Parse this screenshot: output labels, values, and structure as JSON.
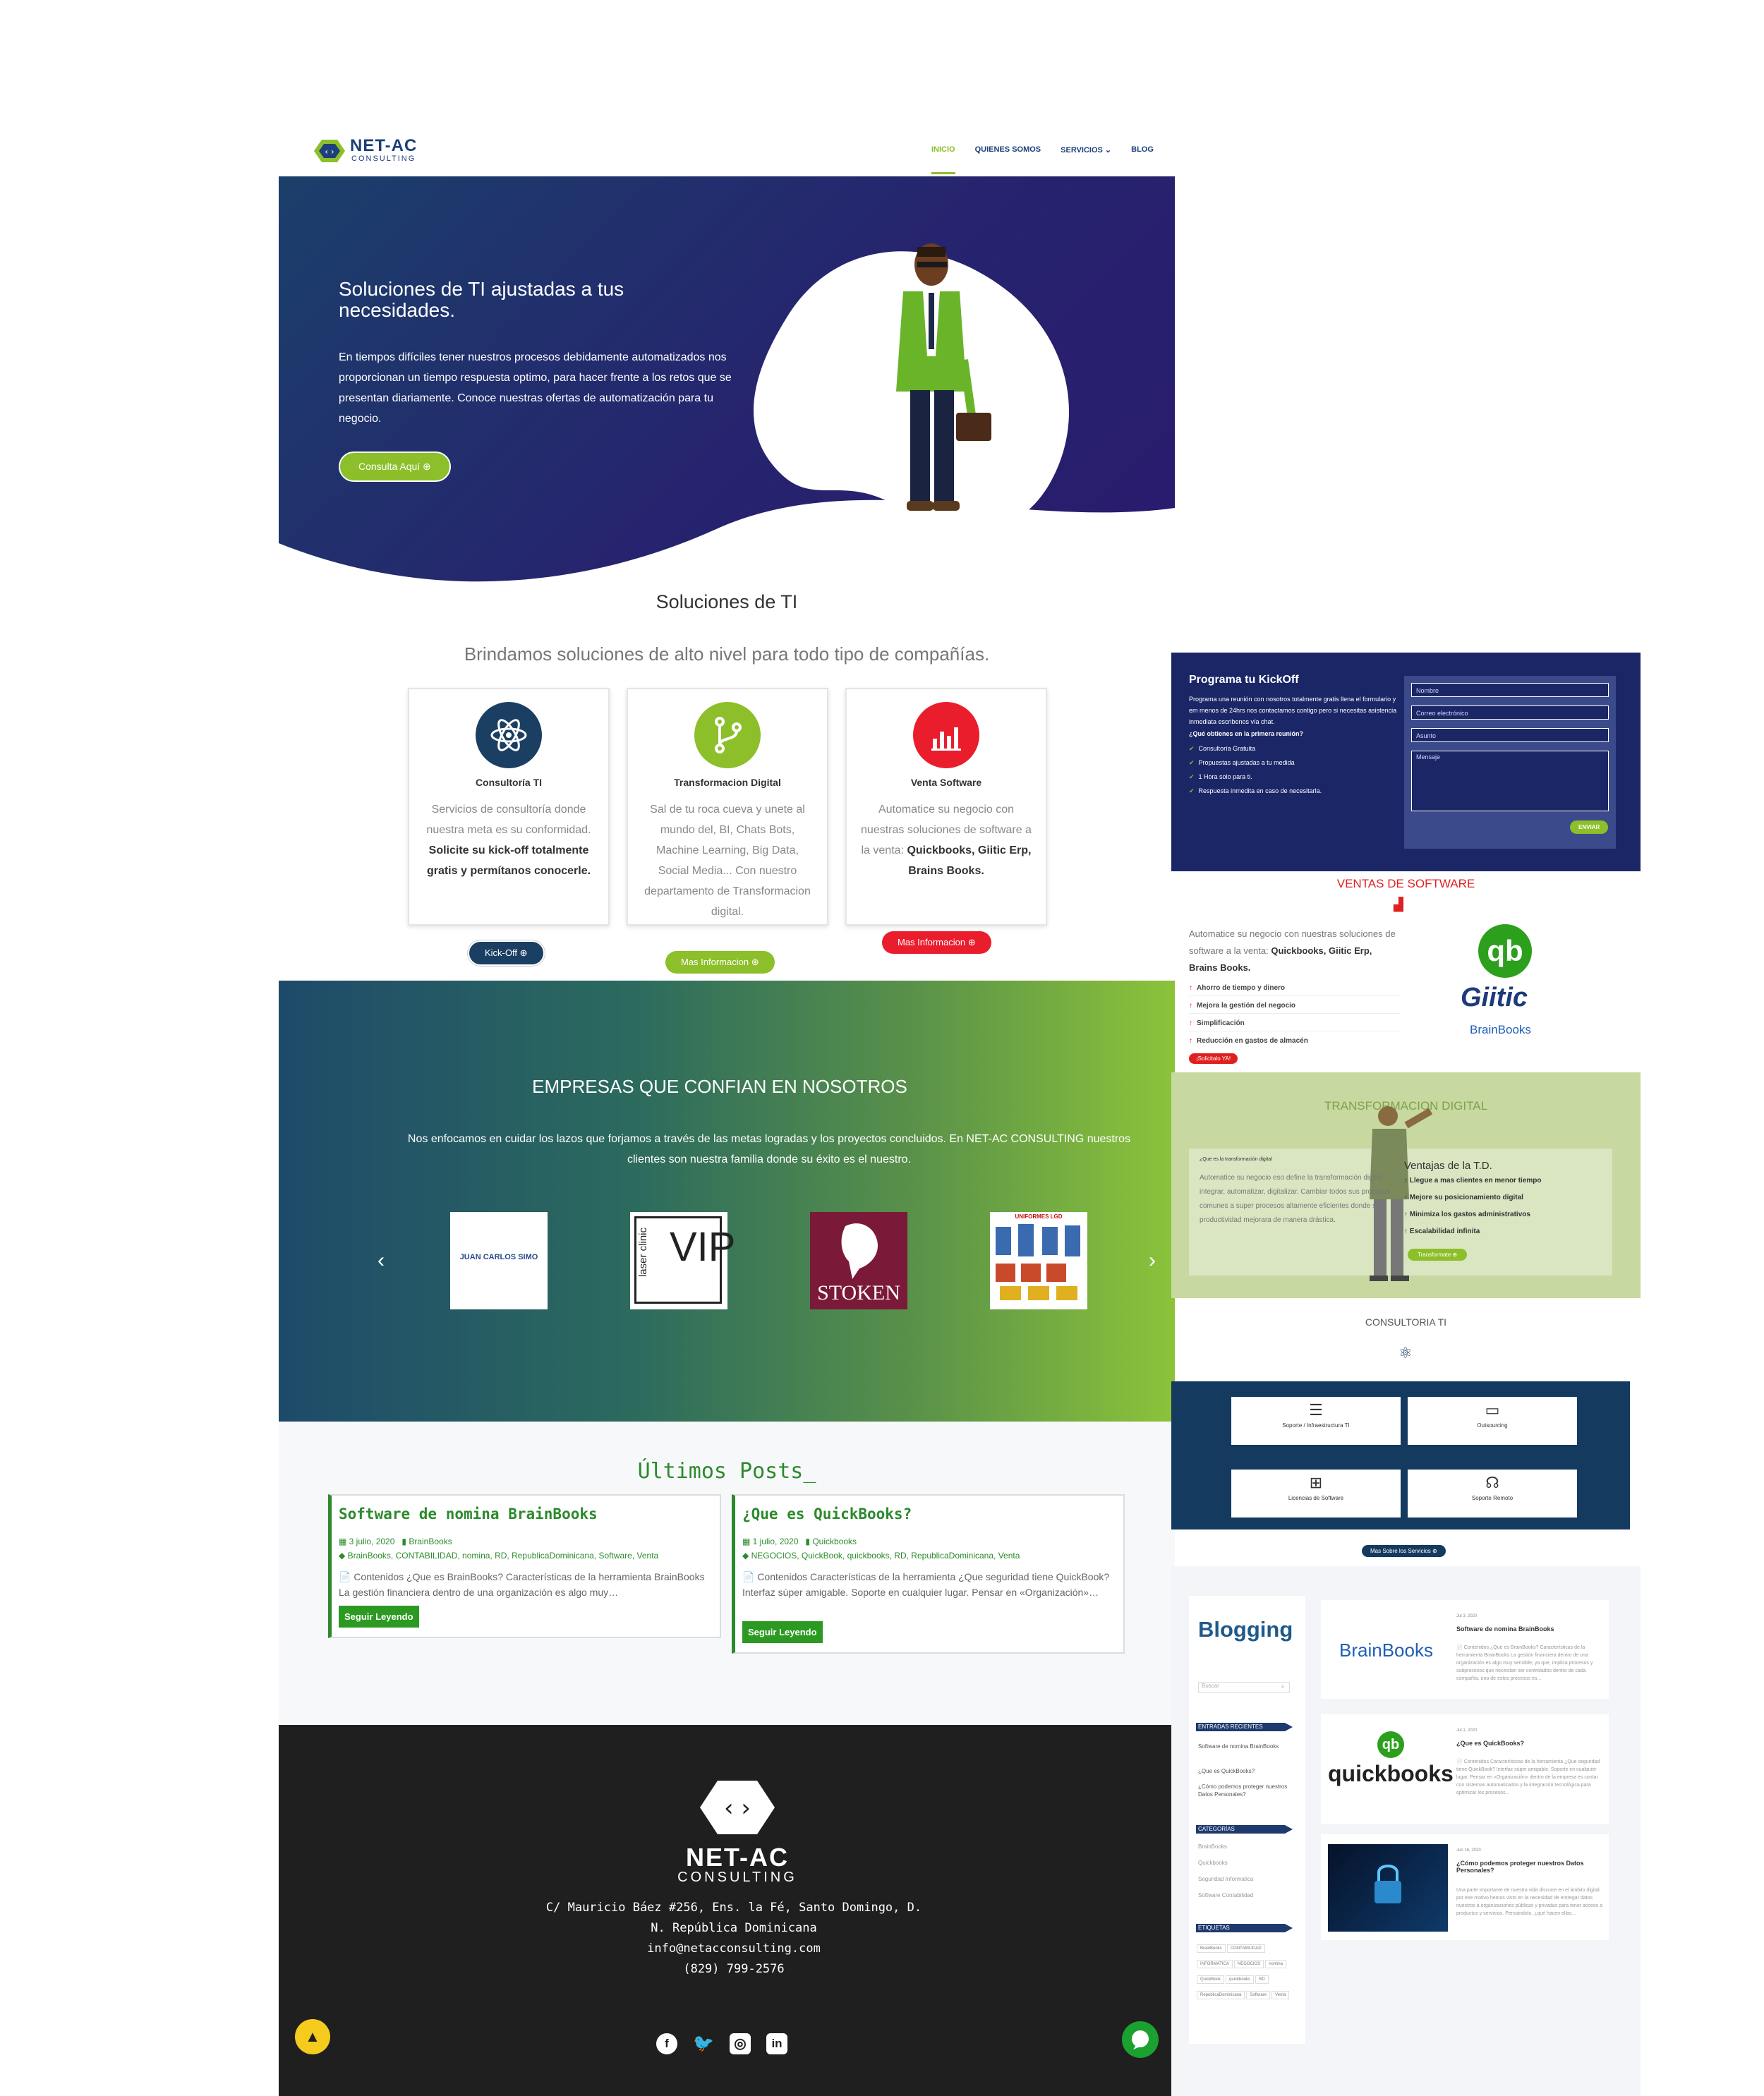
{
  "header": {
    "logo_text": "NET-AC",
    "logo_sub": "CONSULTING",
    "nav": [
      "INICIO",
      "QUIENES SOMOS",
      "SERVICIOS ⌄",
      "BLOG"
    ]
  },
  "hero": {
    "title": "Soluciones de TI ajustadas a tus necesidades.",
    "body": "En tiempos difíciles tener nuestros procesos debidamente automatizados nos proporcionan un tiempo respuesta optimo, para hacer frente a los retos que se presentan diariamente. Conoce nuestras ofertas de automatización para tu negocio.",
    "button": "Consulta Aquí ⊕"
  },
  "solutions": {
    "title": "Soluciones de TI",
    "subtitle": "Brindamos soluciones de alto nivel para todo tipo de compañías.",
    "cards": [
      {
        "title": "Consultoría TI",
        "text_before": "Servicios de consultoría donde nuestra meta es su conformidad. ",
        "text_bold": "Solicite su kick-off totalmente gratis y permítanos conocerle.",
        "button": "Kick-Off ⊕",
        "icon": "atom-icon",
        "color": "#1b3f63",
        "button_color": "#1b3f63"
      },
      {
        "title": "Transformacion Digital",
        "text_before": "Sal de tu roca cueva y unete al mundo del, BI, Chats Bots, Machine Learning, Big Data, Social Media... Con nuestro departamento de Transformacion digital.",
        "text_bold": "",
        "button": "Mas Informacion ⊕",
        "icon": "git-branch-icon",
        "color": "#8cbf2a",
        "button_color": "#8cbf2a"
      },
      {
        "title": "Venta Software",
        "text_before": "Automatice su negocio con nuestras soluciones de software a la venta: ",
        "text_bold": "Quickbooks, Giitic Erp, Brains Books.",
        "button": "Mas Informacion ⊕",
        "icon": "bar-chart-icon",
        "color": "#ea1d2c",
        "button_color": "#ea1d2c"
      }
    ]
  },
  "empresas": {
    "title": "EMPRESAS QUE CONFIAN EN NOSOTROS",
    "body": "Nos enfocamos en cuidar los lazos que forjamos a través de las metas logradas y los proyectos concluidos. En NET-AC CONSULTING nuestros clientes son nuestra familia donde su éxito es el nuestro.",
    "brands": [
      "JUAN CARLOS SIMO",
      "laser clinic VIP",
      "STOKEN",
      "UNIFORMES LGD"
    ]
  },
  "posts": {
    "title": "Últimos Posts_",
    "items": [
      {
        "title": "Software de nomina BrainBooks",
        "date": "3 julio, 2020",
        "category": "BrainBooks",
        "tags": "BrainBooks, CONTABILIDAD, nomina, RD, RepublicaDominicana, Software, Venta",
        "excerpt": "📄 Contenidos ¿Que es BrainBooks? Características de la herramienta BrainBooks La gestión financiera dentro de una organización es algo muy…",
        "button": "Seguir Leyendo"
      },
      {
        "title": "¿Que es QuickBooks?",
        "date": "1 julio, 2020",
        "category": "Quickbooks",
        "tags": "NEGOCIOS, QuickBook, quickbooks, RD, RepublicaDominicana, Venta",
        "excerpt": "📄 Contenidos Características de la herramienta ¿Que seguridad tiene QuickBook? Interfaz súper amigable. Soporte en cualquier lugar. Pensar en «Organización»…",
        "button": "Seguir Leyendo"
      }
    ]
  },
  "footer": {
    "logo_name": "NET-AC",
    "logo_sub": "CONSULTING",
    "address_1": "C/ Mauricio Báez #256, Ens. la Fé, Santo Domingo, D.",
    "address_2": "N. República Dominicana",
    "email": "info@netacconsulting.com",
    "phone": "(829) 799-2576",
    "socials": [
      "facebook-icon",
      "twitter-icon",
      "instagram-icon",
      "linkedin-icon"
    ]
  },
  "kickoff": {
    "title": "Programa tu KickOff",
    "body": "Programa una reunión con nosotros totalmente gratis llena el formulario y em menos de 24hrs nos contactamos contigo pero si necesitas asistencia inmediata escribenos vía chat.",
    "question": "¿Qué obtienes en la primera reunión?",
    "items": [
      "Consultoría Gratuita",
      "Propuestas ajustadas a tu medida",
      "1 Hora solo para ti.",
      "Respuesta inmedita en caso de necesitarla."
    ],
    "fields": [
      "Nombre",
      "Correo electrónico",
      "Asunto",
      "Mensaje"
    ],
    "button": "ENVIAR"
  },
  "ventas": {
    "title": "VENTAS DE SOFTWARE",
    "body_before": "Automatice su negocio con nuestras soluciones de software a la venta: ",
    "body_bold": "Quickbooks, Giitic Erp, Brains Books.",
    "items": [
      "Ahorro de tiempo y dinero",
      "Mejora la gestión del negocio",
      "Simplificación",
      "Reducción en gastos de almacén"
    ],
    "button": "¡Solicitalo YA!",
    "logos": [
      "qb",
      "Giitic",
      "BrainBooks"
    ]
  },
  "transformacion": {
    "title": "TRANSFORMACION DIGITAL",
    "label": "¿Que es la transformación digital",
    "body": "Automatice su negocio eso define la transformación digital, integrar, automatizar, digitalizar. Cambiar todos sus procesos comunes a super procesos altamente eficientes donde su productividad mejorara de manera drástica.",
    "heading": "Ventajas de la T.D.",
    "items": [
      "Llegue a mas clientes en menor tiempo",
      "Mejore su posicionamiento digital",
      "Minimiza los gastos administrativos",
      "Escalabilidad infinita"
    ],
    "button": "Transformate ⊕"
  },
  "consultoria": {
    "title": "CONSULTORIA TI",
    "cards": [
      "Soporte / Infraestructura TI",
      "Outsourcing",
      "Licencias de Software",
      "Soporte Remoto"
    ],
    "button": "Mas Sobre los Servicios ⊕"
  },
  "blog": {
    "title": "Blogging",
    "search": "Buscar",
    "recent_label": "ENTRADAS RECIENTES",
    "recent": [
      "Software de nomina BrainBooks",
      "¿Que es QuickBooks?",
      "¿Cómo podemos proteger nuestros Datos Personales?"
    ],
    "categories_label": "CATEGORÍAS",
    "categories": [
      "BrainBooks",
      "Quickbooks",
      "Seguridad Informatica",
      "Software Contabilidad"
    ],
    "tags_label": "ETIQUETAS",
    "tags": [
      "BrainBooks",
      "CONTABILIDAD",
      "INFORMATICA",
      "NEGOCIOS",
      "nomina",
      "QuickBook",
      "quickbooks",
      "RD",
      "RepublicaDominicana",
      "Software",
      "Venta"
    ],
    "posts": [
      {
        "date": "Jul 3, 2020",
        "title": "Software de nomina BrainBooks",
        "text": "📄 Contenidos ¿Que es BrainBooks? Características de la herramienta BrainBooks La gestión financiera dentro de una organización es algo muy sensible, ya que, implica procesos y subprocesos que necesitan ser controlados dentro de cada compañía, uno de estos procesos es...",
        "image": "BrainBooks"
      },
      {
        "date": "Jul 1, 2020",
        "title": "¿Que es QuickBooks?",
        "text": "📄 Contenidos Características de la herramienta ¿Que seguridad tiene QuickBook? Interfaz súper amigable. Soporte en cualquier lugar. Pensar en «Organización» dentro de la empresa es contar con sistemas automatizados y la integración tecnológica para optimizar los procesos...",
        "image": "quickbooks"
      },
      {
        "date": "Jun 16, 2020",
        "title": "¿Cómo podemos proteger nuestros Datos Personales?",
        "text": "Una parte importante de nuestra vida discurre en el ámbito digital: por ese motivo hemos visto en la necesidad de entregar datos nuestros a organizaciones públicas y privadas para tener acceso a productos y servicios. Pensándolo, ¿qué hacen ellas...",
        "image": ""
      }
    ]
  }
}
